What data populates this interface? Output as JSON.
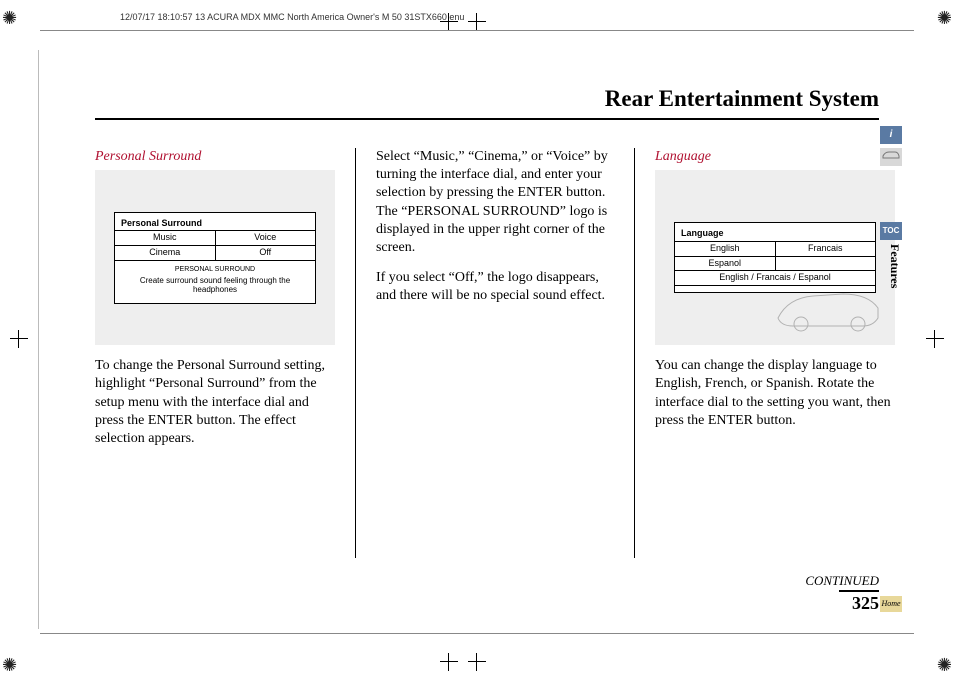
{
  "print_header": "12/07/17 18:10:57   13 ACURA MDX MMC North America Owner's M 50 31STX660 enu",
  "page_title": "Rear Entertainment System",
  "col1": {
    "heading": "Personal Surround",
    "screen": {
      "title": "Personal Surround",
      "opt_music": "Music",
      "opt_voice": "Voice",
      "opt_cinema": "Cinema",
      "opt_off": "Off",
      "logo": "PERSONAL SURROUND",
      "caption": "Create surround sound feeling through the headphones"
    },
    "body": "To change the Personal Surround setting, highlight “Personal Surround” from the setup menu with the interface dial and press the ENTER button. The effect selection appears."
  },
  "col2": {
    "para1": "Select “Music,” “Cinema,” or “Voice” by turning the interface dial, and enter your selection by pressing the ENTER button. The “PERSONAL SURROUND” logo is displayed in the upper right corner of the screen.",
    "para2": "If you select “Off,” the logo disappears, and there will be no special sound effect."
  },
  "col3": {
    "heading": "Language",
    "screen": {
      "title": "Language",
      "opt_english": "English",
      "opt_francais": "Francais",
      "opt_espanol": "Espanol",
      "opt_all": "English / Francais / Espanol"
    },
    "body": "You can change the display language to English, French, or Spanish. Rotate the interface dial to the setting you want, then press the ENTER button."
  },
  "continued": "CONTINUED",
  "page_number": "325",
  "tabs": {
    "info": "i",
    "toc": "TOC",
    "section": "Features",
    "home": "Home"
  }
}
